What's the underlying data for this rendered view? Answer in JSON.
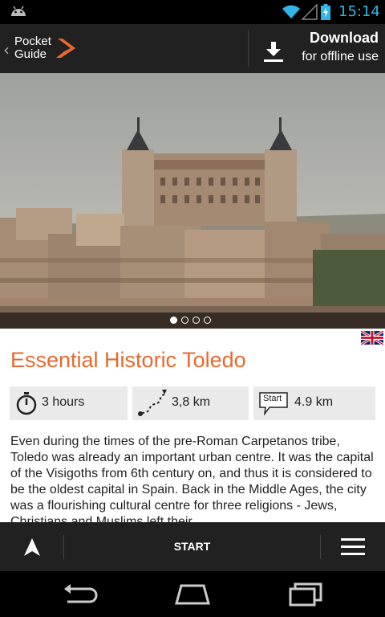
{
  "status_bar": {
    "time": "15:14",
    "icons": [
      "android-notification-icon",
      "wifi-icon",
      "signal-icon",
      "battery-charging-icon"
    ],
    "clock_color": "#33b5e5"
  },
  "action_bar": {
    "logo_line1": "Pocket",
    "logo_line2": "Guide",
    "download_label": "Download",
    "download_sublabel": "for offline use",
    "accent": "#e8692e"
  },
  "hero": {
    "slide_count": 4,
    "active_slide": 1
  },
  "tour": {
    "title": "Essential Historic Toledo",
    "title_color": "#e8692e",
    "duration": "3 hours",
    "distance": "3,8 km",
    "start_distance": "4.9 km",
    "start_badge": "Start",
    "language_flag": "uk-flag",
    "description": "Even during the times of the pre-Roman Carpetanos tribe, Toledo was already an important urban centre. It was the capital of the Visigoths from 6th century on, and thus it is considered to be the oldest capital in Spain. Back in the Middle Ages, the city was a flourishing cultural centre for three religions - Jews, Christians and Muslims left their..."
  },
  "bottom_bar": {
    "start_label": "START",
    "icons": [
      "navigation-arrow-icon",
      "menu-icon"
    ]
  },
  "system_nav": {
    "icons": [
      "back-icon",
      "home-icon",
      "recent-apps-icon"
    ]
  }
}
